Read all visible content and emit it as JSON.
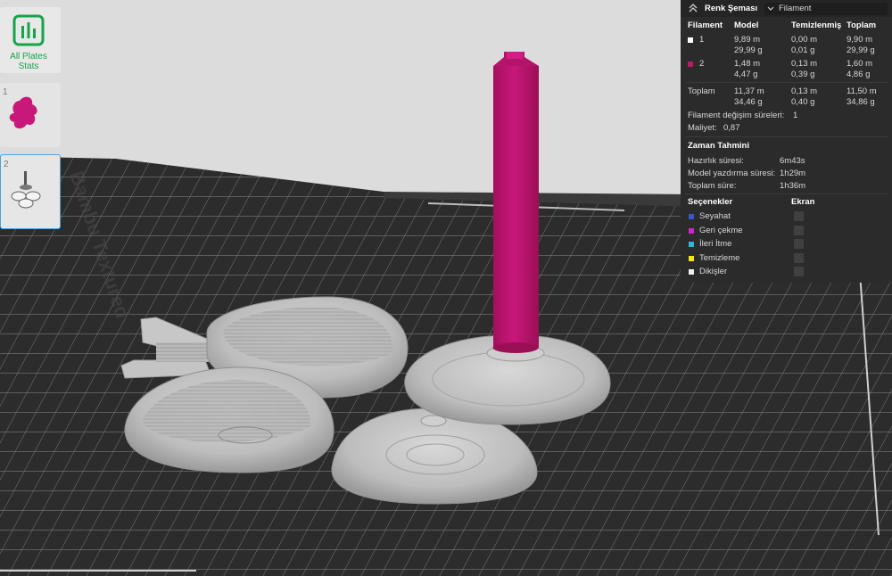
{
  "left_panel": {
    "all_plates_label_line1": "All Plates",
    "all_plates_label_line2": "Stats",
    "plate1_number": "1",
    "plate2_number": "2"
  },
  "bed": {
    "brand_text": "Bambu Textured"
  },
  "panel": {
    "header_title": "Renk Şeması",
    "view_mode": "Filament",
    "table_headers": [
      "Filament",
      "Model",
      "Temizlenmiş",
      "Toplam"
    ],
    "rows": [
      {
        "label": "1",
        "color": "#ffffff",
        "model": [
          "9,89 m",
          "29,99 g"
        ],
        "purged": [
          "0,00 m",
          "0,01 g"
        ],
        "total": [
          "9,90 m",
          "29,99 g"
        ]
      },
      {
        "label": "2",
        "color": "#c2186b",
        "model": [
          "1,48 m",
          "4,47 g"
        ],
        "purged": [
          "0,13 m",
          "0,39 g"
        ],
        "total": [
          "1,60 m",
          "4,86 g"
        ]
      }
    ],
    "totals": {
      "label": "Toplam",
      "model": [
        "11,37 m",
        "34,46 g"
      ],
      "purged": [
        "0,13 m",
        "0,40 g"
      ],
      "total": [
        "11,50 m",
        "34,86 g"
      ]
    },
    "filament_change_label": "Filament değişim süreleri:",
    "filament_change_value": "1",
    "cost_label": "Maliyet:",
    "cost_value": "0,87",
    "time_section_title": "Zaman Tahmini",
    "times": [
      {
        "label": "Hazırlık süresi:",
        "value": "6m43s"
      },
      {
        "label": "Model yazdırma süresi:",
        "value": "1h29m"
      },
      {
        "label": "Toplam süre:",
        "value": "1h36m"
      }
    ],
    "options_title": "Seçenekler",
    "display_title": "Ekran",
    "options": [
      {
        "label": "Seyahat",
        "color": "#3a56c8"
      },
      {
        "label": "Geri çekme",
        "color": "#d024c8"
      },
      {
        "label": "İleri İtme",
        "color": "#2fb3d9"
      },
      {
        "label": "Temizleme",
        "color": "#f2e51b"
      },
      {
        "label": "Dikişler",
        "color": "#efefef"
      }
    ]
  }
}
